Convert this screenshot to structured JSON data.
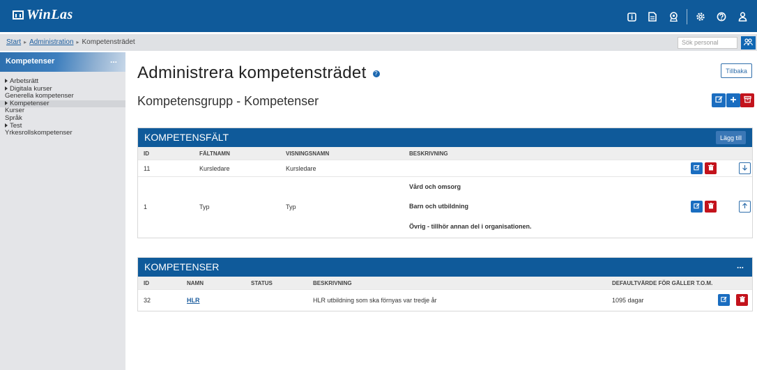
{
  "app": {
    "logo_text": "WinLas"
  },
  "topbar": {
    "icons": [
      "info-icon",
      "document-icon",
      "badge-icon",
      "settings-icon",
      "help-icon",
      "user-icon"
    ]
  },
  "breadcrumb": {
    "start": "Start",
    "admin": "Administration",
    "current": "Kompetensträdet"
  },
  "search": {
    "placeholder": "Sök personal"
  },
  "sidebar": {
    "title": "Kompetenser",
    "menu": "...",
    "items": [
      {
        "label": "Arbetsrätt",
        "expandable": true
      },
      {
        "label": "Digitala kurser",
        "expandable": true
      },
      {
        "label": "Generella kompetenser",
        "expandable": false
      },
      {
        "label": "Kompetenser",
        "expandable": true,
        "active": true
      },
      {
        "label": "Kurser",
        "expandable": false
      },
      {
        "label": "Språk",
        "expandable": false
      },
      {
        "label": "Test",
        "expandable": true
      },
      {
        "label": "Yrkesrollskompetenser",
        "expandable": false
      }
    ]
  },
  "main": {
    "title": "Administrera kompetensträdet",
    "subtitle": "Kompetensgrupp - Kompetenser",
    "back_button": "Tillbaka",
    "help_glyph": "?"
  },
  "fields_panel": {
    "title": "KOMPETENSFÄLT",
    "add_button": "Lägg till",
    "columns": [
      "ID",
      "FÄLTNAMN",
      "VISNINGSNAMN",
      "BESKRIVNING"
    ],
    "rows": [
      {
        "id": "11",
        "field_name": "Kursledare",
        "display_name": "Kursledare",
        "description": []
      },
      {
        "id": "1",
        "field_name": "Typ",
        "display_name": "Typ",
        "description": [
          "Vård och omsorg",
          "Barn och utbildning",
          "Övrig - tillhör annan del i organisationen."
        ]
      }
    ]
  },
  "competence_panel": {
    "title": "KOMPETENSER",
    "menu": "...",
    "columns": [
      "ID",
      "NAMN",
      "STATUS",
      "BESKRIVNING",
      "DEFAULTVÄRDE FÖR GÄLLER T.O.M."
    ],
    "rows": [
      {
        "id": "32",
        "name": "HLR",
        "status": "",
        "description": "HLR utbildning som ska förnyas var tredje år",
        "default_value": "1095 dagar"
      }
    ]
  },
  "colors": {
    "header_blue": "#0f5a9a",
    "button_blue": "#1a6dc0",
    "button_red": "#c3131c",
    "sidebar_bg": "#e4e5e8"
  }
}
